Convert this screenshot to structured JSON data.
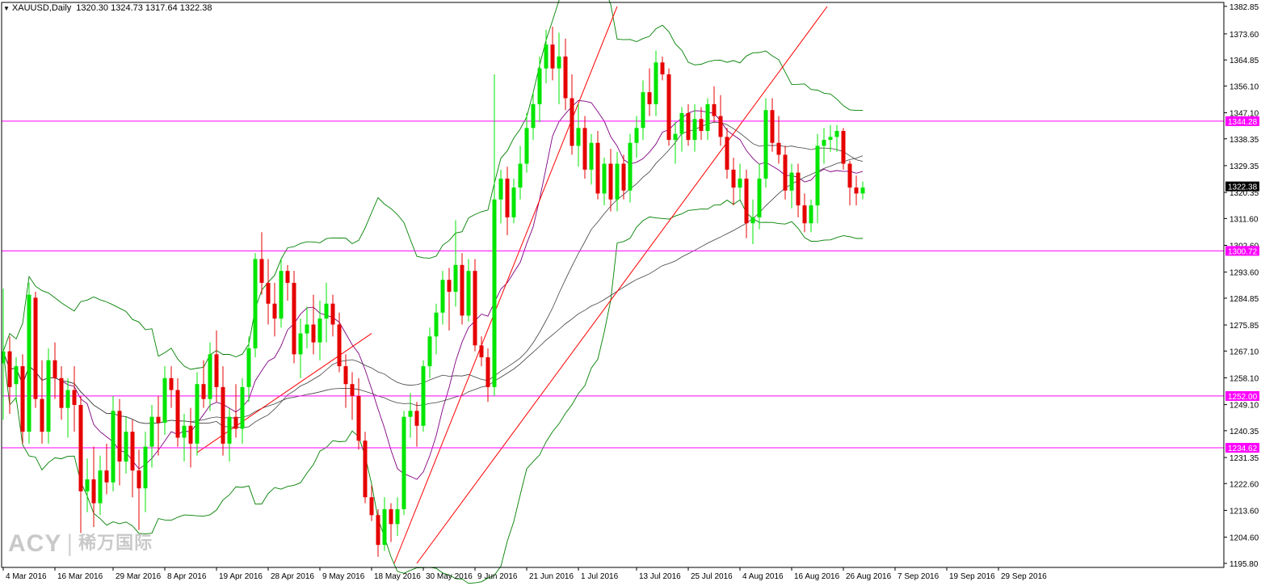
{
  "header": {
    "symbol": "XAUUSD,Daily",
    "ohlc": "1320.30 1324.73 1317.64 1322.38"
  },
  "watermark": {
    "brand": "ACY",
    "cn": "稀万国际"
  },
  "colors": {
    "bull": "#00e600",
    "bear": "#e60000",
    "grid": "#000000",
    "level": "#ff00ff",
    "trend": "#ff0000",
    "band": "#008000",
    "ma_purple": "#800080",
    "ma_gray": "#404040"
  },
  "chart_data": {
    "type": "candlestick",
    "timeframe": "Daily",
    "ylim": [
      1195.8,
      1382.8
    ],
    "y_ticks": [
      "1382.85",
      "1373.60",
      "1364.85",
      "1356.10",
      "1347.10",
      "1338.35",
      "1329.35",
      "1320.35",
      "1311.60",
      "1302.60",
      "1293.60",
      "1284.85",
      "1275.85",
      "1267.10",
      "1258.10",
      "1249.10",
      "1240.35",
      "1231.35",
      "1222.60",
      "1213.60",
      "1204.60",
      "1195.80"
    ],
    "x_ticks": [
      {
        "i": 0,
        "label": "4 Mar 2016"
      },
      {
        "i": 8,
        "label": "16 Mar 2016"
      },
      {
        "i": 17,
        "label": "29 Mar 2016"
      },
      {
        "i": 25,
        "label": "8 Apr 2016"
      },
      {
        "i": 33,
        "label": "19 Apr 2016"
      },
      {
        "i": 41,
        "label": "28 Apr 2016"
      },
      {
        "i": 49,
        "label": "9 May 2016"
      },
      {
        "i": 57,
        "label": "18 May 2016"
      },
      {
        "i": 65,
        "label": "30 May 2016"
      },
      {
        "i": 73,
        "label": "9 Jun 2016"
      },
      {
        "i": 81,
        "label": "21 Jun 2016"
      },
      {
        "i": 89,
        "label": "1 Jul 2016"
      },
      {
        "i": 98,
        "label": "13 Jul 2016"
      },
      {
        "i": 106,
        "label": "25 Jul 2016"
      },
      {
        "i": 114,
        "label": "4 Aug 2016"
      },
      {
        "i": 122,
        "label": "16 Aug 2016"
      },
      {
        "i": 130,
        "label": "26 Aug 2016"
      },
      {
        "i": 138,
        "label": "7 Sep 2016"
      },
      {
        "i": 146,
        "label": "19 Sep 2016"
      },
      {
        "i": 154,
        "label": "29 Sep 2016"
      }
    ],
    "levels": [
      {
        "price": 1344.28,
        "label": "1344.28"
      },
      {
        "price": 1300.72,
        "label": "1300.72"
      },
      {
        "price": 1252.0,
        "label": "1252.00"
      },
      {
        "price": 1234.62,
        "label": "1234.62"
      }
    ],
    "current_price": "1322.38",
    "trendlines": [
      {
        "i1": 60.5,
        "p1": 1195.8,
        "i2": 95.0,
        "p2": 1382.8
      },
      {
        "i1": 64.0,
        "p1": 1195.8,
        "i2": 127.5,
        "p2": 1382.8
      },
      {
        "i1": 30.0,
        "p1": 1233.0,
        "i2": 57.0,
        "p2": 1273.0
      }
    ],
    "candles": [
      [
        1263,
        1288,
        1244,
        1267
      ],
      [
        1267,
        1272,
        1246,
        1255
      ],
      [
        1256,
        1265,
        1250,
        1262
      ],
      [
        1262,
        1266,
        1236,
        1240
      ],
      [
        1240,
        1290,
        1236,
        1286
      ],
      [
        1285,
        1287,
        1248,
        1251
      ],
      [
        1251,
        1264,
        1236,
        1240
      ],
      [
        1240,
        1268,
        1236,
        1264
      ],
      [
        1264,
        1270,
        1251,
        1258
      ],
      [
        1258,
        1262,
        1244,
        1248
      ],
      [
        1248,
        1258,
        1238,
        1254
      ],
      [
        1254,
        1262,
        1240,
        1249
      ],
      [
        1249,
        1252,
        1206,
        1220
      ],
      [
        1220,
        1231,
        1213,
        1224
      ],
      [
        1224,
        1235,
        1208,
        1216
      ],
      [
        1216,
        1232,
        1212,
        1227
      ],
      [
        1227,
        1236,
        1219,
        1223
      ],
      [
        1223,
        1252,
        1220,
        1247
      ],
      [
        1247,
        1251,
        1222,
        1230
      ],
      [
        1230,
        1245,
        1226,
        1240
      ],
      [
        1240,
        1244,
        1218,
        1227
      ],
      [
        1227,
        1234,
        1207,
        1221
      ],
      [
        1221,
        1240,
        1213,
        1235
      ],
      [
        1235,
        1249,
        1228,
        1245
      ],
      [
        1245,
        1252,
        1232,
        1243
      ],
      [
        1243,
        1262,
        1239,
        1258
      ],
      [
        1258,
        1262,
        1248,
        1254
      ],
      [
        1254,
        1258,
        1235,
        1238
      ],
      [
        1238,
        1246,
        1230,
        1242
      ],
      [
        1242,
        1248,
        1228,
        1236
      ],
      [
        1236,
        1260,
        1232,
        1256
      ],
      [
        1256,
        1264,
        1248,
        1251
      ],
      [
        1251,
        1270,
        1247,
        1266
      ],
      [
        1266,
        1274,
        1250,
        1255
      ],
      [
        1255,
        1262,
        1232,
        1236
      ],
      [
        1236,
        1248,
        1230,
        1245
      ],
      [
        1245,
        1256,
        1238,
        1241
      ],
      [
        1241,
        1258,
        1236,
        1255
      ],
      [
        1255,
        1272,
        1250,
        1268
      ],
      [
        1268,
        1300,
        1265,
        1298
      ],
      [
        1298,
        1307,
        1286,
        1290
      ],
      [
        1290,
        1298,
        1276,
        1283
      ],
      [
        1283,
        1290,
        1272,
        1278
      ],
      [
        1278,
        1298,
        1275,
        1294
      ],
      [
        1294,
        1296,
        1284,
        1290
      ],
      [
        1290,
        1294,
        1263,
        1266
      ],
      [
        1266,
        1278,
        1258,
        1273
      ],
      [
        1273,
        1282,
        1268,
        1276
      ],
      [
        1276,
        1286,
        1266,
        1270
      ],
      [
        1270,
        1284,
        1264,
        1278
      ],
      [
        1278,
        1290,
        1270,
        1283
      ],
      [
        1283,
        1286,
        1272,
        1276
      ],
      [
        1276,
        1280,
        1260,
        1262
      ],
      [
        1262,
        1266,
        1248,
        1256
      ],
      [
        1256,
        1260,
        1244,
        1252
      ],
      [
        1252,
        1258,
        1234,
        1237
      ],
      [
        1237,
        1240,
        1216,
        1218
      ],
      [
        1218,
        1222,
        1210,
        1212
      ],
      [
        1212,
        1214,
        1198,
        1202
      ],
      [
        1202,
        1218,
        1200,
        1214
      ],
      [
        1214,
        1216,
        1203,
        1209
      ],
      [
        1209,
        1218,
        1205,
        1214
      ],
      [
        1214,
        1247,
        1212,
        1245
      ],
      [
        1245,
        1253,
        1238,
        1247
      ],
      [
        1247,
        1250,
        1235,
        1242
      ],
      [
        1242,
        1264,
        1240,
        1262
      ],
      [
        1262,
        1275,
        1258,
        1272
      ],
      [
        1272,
        1283,
        1266,
        1280
      ],
      [
        1280,
        1294,
        1276,
        1291
      ],
      [
        1291,
        1295,
        1274,
        1287
      ],
      [
        1287,
        1311,
        1282,
        1296
      ],
      [
        1296,
        1300,
        1276,
        1279
      ],
      [
        1279,
        1298,
        1277,
        1294
      ],
      [
        1294,
        1298,
        1267,
        1269
      ],
      [
        1269,
        1272,
        1262,
        1265
      ],
      [
        1265,
        1268,
        1250,
        1255
      ],
      [
        1255,
        1360,
        1252,
        1318
      ],
      [
        1318,
        1328,
        1310,
        1325
      ],
      [
        1325,
        1329,
        1306,
        1312
      ],
      [
        1312,
        1325,
        1310,
        1322
      ],
      [
        1322,
        1336,
        1318,
        1330
      ],
      [
        1330,
        1347,
        1327,
        1342
      ],
      [
        1342,
        1354,
        1338,
        1350
      ],
      [
        1350,
        1366,
        1344,
        1362
      ],
      [
        1362,
        1375,
        1357,
        1370
      ],
      [
        1370,
        1376,
        1358,
        1362
      ],
      [
        1362,
        1374,
        1350,
        1366
      ],
      [
        1366,
        1372,
        1348,
        1352
      ],
      [
        1352,
        1360,
        1333,
        1336
      ],
      [
        1336,
        1350,
        1329,
        1342
      ],
      [
        1342,
        1346,
        1325,
        1328
      ],
      [
        1328,
        1340,
        1323,
        1337
      ],
      [
        1337,
        1341,
        1318,
        1320
      ],
      [
        1320,
        1332,
        1316,
        1330
      ],
      [
        1330,
        1335,
        1314,
        1318
      ],
      [
        1318,
        1334,
        1314,
        1330
      ],
      [
        1330,
        1333,
        1318,
        1321
      ],
      [
        1321,
        1340,
        1317,
        1337
      ],
      [
        1337,
        1346,
        1332,
        1342
      ],
      [
        1342,
        1358,
        1338,
        1354
      ],
      [
        1354,
        1362,
        1346,
        1350
      ],
      [
        1350,
        1368,
        1346,
        1364
      ],
      [
        1364,
        1366,
        1358,
        1360
      ],
      [
        1360,
        1362,
        1336,
        1338
      ],
      [
        1338,
        1344,
        1330,
        1340
      ],
      [
        1340,
        1349,
        1334,
        1347
      ],
      [
        1347,
        1350,
        1336,
        1338
      ],
      [
        1338,
        1350,
        1334,
        1345
      ],
      [
        1345,
        1349,
        1338,
        1341
      ],
      [
        1341,
        1352,
        1338,
        1350
      ],
      [
        1350,
        1356,
        1344,
        1346
      ],
      [
        1346,
        1353,
        1336,
        1339
      ],
      [
        1339,
        1342,
        1325,
        1328
      ],
      [
        1328,
        1332,
        1316,
        1322
      ],
      [
        1322,
        1330,
        1318,
        1325
      ],
      [
        1325,
        1328,
        1305,
        1310
      ],
      [
        1310,
        1318,
        1303,
        1312
      ],
      [
        1312,
        1330,
        1308,
        1325
      ],
      [
        1325,
        1352,
        1322,
        1348
      ],
      [
        1348,
        1352,
        1334,
        1337
      ],
      [
        1337,
        1346,
        1330,
        1333
      ],
      [
        1333,
        1336,
        1318,
        1321
      ],
      [
        1321,
        1330,
        1315,
        1327
      ],
      [
        1327,
        1330,
        1312,
        1316
      ],
      [
        1316,
        1320,
        1307,
        1310
      ],
      [
        1310,
        1318,
        1307,
        1316
      ],
      [
        1316,
        1340,
        1310,
        1336
      ],
      [
        1336,
        1342,
        1330,
        1338
      ],
      [
        1338,
        1343,
        1334,
        1339
      ],
      [
        1339,
        1343,
        1334,
        1341
      ],
      [
        1341,
        1342,
        1328,
        1330
      ],
      [
        1330,
        1331,
        1316,
        1322
      ],
      [
        1322,
        1326,
        1316,
        1320
      ],
      [
        1320,
        1324,
        1318,
        1322
      ]
    ]
  }
}
